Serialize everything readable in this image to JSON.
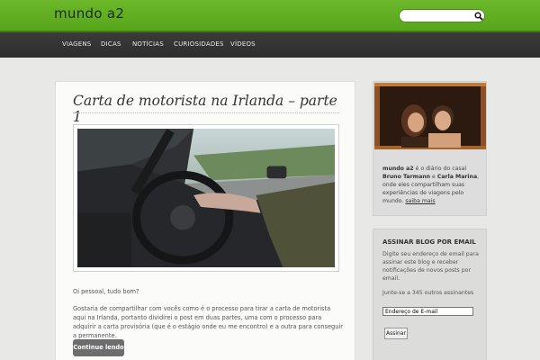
{
  "header": {
    "site_title": "mundo a2",
    "search": {
      "value": ""
    }
  },
  "nav": {
    "items": [
      {
        "label": "VIAGENS"
      },
      {
        "label": "DICAS"
      },
      {
        "label": "NOTÍCIAS"
      },
      {
        "label": "CURIOSIDADES"
      },
      {
        "label": "VÍDEOS"
      }
    ]
  },
  "post": {
    "title": "Carta de motorista na Irlanda – parte 1",
    "greeting": "Oi pessoal, tudo bom?",
    "body": "Gostaria de compartilhar com vocês como é o processo para tirar a carta de motorista aqui na Irlanda, portanto dividirei o post em duas partes, uma com o processo para adquirir a carta provisória (que é o estágio onde eu me encontro) e a outra para conseguir a permanente.",
    "continue_label": "Continue lendo"
  },
  "sidebar": {
    "about": {
      "name": "mundo a2",
      "t1": " é o diário do casal ",
      "person1": "Bruno Tarmann",
      "t2": " e ",
      "person2": "Carla Marina",
      "t3": ", onde eles compartilham suas experiências de viagens pelo mundo. ",
      "more_label": "saiba mais"
    },
    "subscribe": {
      "title": "ASSINAR BLOG POR EMAIL",
      "description": "Digite seu endereço de email para assinar este blog e receber notificações de novos posts por email.",
      "subscribers": "Junte-se a 345 outros assinantes",
      "email_value": "Endereço de E-mail",
      "button_label": "Assinar"
    }
  },
  "colors": {
    "header_green": "#62ae22",
    "navbar_dark": "#333333",
    "button_gray": "#6d6d6d"
  }
}
